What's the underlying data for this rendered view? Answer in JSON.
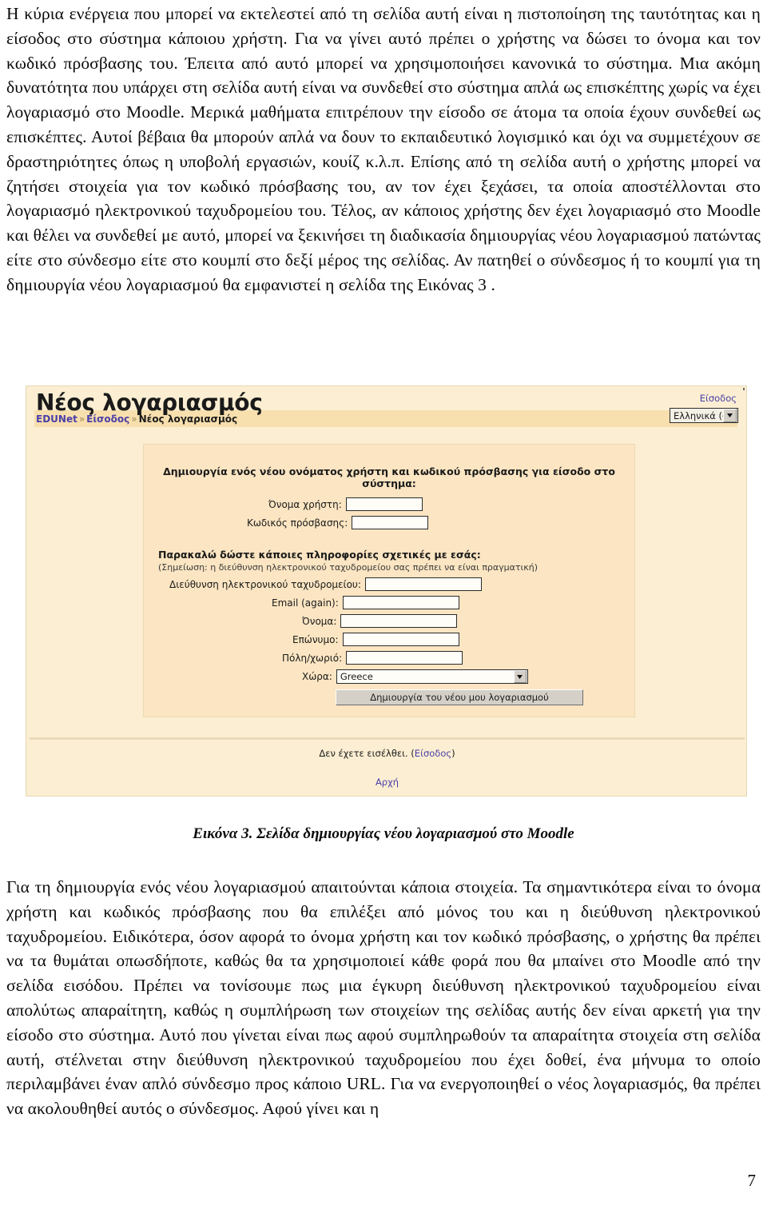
{
  "document": {
    "page_number": "7",
    "paragraph_top": "Η κύρια ενέργεια που μπορεί να εκτελεστεί από τη σελίδα αυτή είναι η πιστοποίηση της ταυτότητας και η είσοδος στο σύστημα κάποιου χρήστη. Για να γίνει αυτό πρέπει ο χρήστης να δώσει το όνομα και τον κωδικό πρόσβασης του. Έπειτα από αυτό μπορεί να χρησιμοποιήσει κανονικά το σύστημα. Μια ακόμη δυνατότητα που υπάρχει στη σελίδα αυτή είναι να συνδεθεί στο σύστημα απλά ως επισκέπτης χωρίς να έχει λογαριασμό στο Moodle. Μερικά μαθήματα επιτρέπουν την είσοδο σε άτομα τα οποία έχουν συνδεθεί ως επισκέπτες. Αυτοί βέβαια θα μπορούν απλά να δουν το εκπαιδευτικό λογισμικό και όχι να συμμετέχουν σε δραστηριότητες όπως η υποβολή εργασιών, κουίζ κ.λ.π. Επίσης από τη σελίδα αυτή ο χρήστης μπορεί να ζητήσει στοιχεία για τον κωδικό πρόσβασης του, αν τον έχει ξεχάσει, τα οποία αποστέλλονται στο λογαριασμό ηλεκτρονικού ταχυδρομείου του. Τέλος, αν κάποιος χρήστης δεν έχει λογαριασμό στο Moodle και θέλει να συνδεθεί με αυτό, μπορεί να ξεκινήσει τη διαδικασία δημιουργίας νέου λογαριασμού πατώντας είτε στο σύνδεσμο είτε στο κουμπί στο δεξί μέρος της σελίδας. Αν πατηθεί ο σύνδεσμος ή το κουμπί για τη δημιουργία νέου λογαριασμού θα εμφανιστεί η σελίδα της Εικόνας 3 .",
    "figure_caption": "Εικόνα 3. Σελίδα δημιουργίας νέου λογαριασμού στο Moodle",
    "paragraph_bottom": "Για τη δημιουργία ενός νέου λογαριασμού απαιτούνται κάποια στοιχεία. Τα σημαντικότερα είναι το όνομα χρήστη και κωδικός πρόσβασης που θα επιλέξει από μόνος του και η διεύθυνση ηλεκτρονικού ταχυδρομείου. Ειδικότερα, όσον αφορά το όνομα χρήστη και τον κωδικό πρόσβασης, ο χρήστης θα πρέπει να τα θυμάται οπωσδήποτε, καθώς θα τα χρησιμοποιεί κάθε φορά που θα μπαίνει στο Moodle από την σελίδα εισόδου. Πρέπει να τονίσουμε πως μια έγκυρη διεύθυνση ηλεκτρονικού ταχυδρομείου είναι απολύτως απαραίτητη, καθώς η συμπλήρωση των στοιχείων της σελίδας αυτής δεν είναι αρκετή για την είσοδο στο σύστημα. Αυτό που γίνεται είναι πως αφού συμπληρωθούν τα απαραίτητα στοιχεία στη σελίδα αυτή, στέλνεται στην διεύθυνση ηλεκτρονικού ταχυδρομείου που έχει δοθεί, ένα μήνυμα το οποίο περιλαμβάνει έναν απλό σύνδεσμο προς κάποιο URL. Για να ενεργοποιηθεί ο νέος λογαριασμός, θα πρέπει να ακολουθηθεί αυτός ο σύνδεσμος. Αφού γίνει και η"
  },
  "screenshot": {
    "title": "Νέος λογαριασμός",
    "login_link": "Είσοδος",
    "language_selected": "Ελληνικά (el)",
    "breadcrumb": {
      "site": "EDUNet",
      "separator": "»",
      "parent": "Είσοδος",
      "current": "Νέος λογαριασμός"
    },
    "form": {
      "section_credentials_title": "Δημιουργία ενός νέου ονόματος χρήστη και κωδικού πρόσβασης για είσοδο στο σύστημα:",
      "username_label": "Όνομα χρήστη:",
      "username_value": "",
      "password_label": "Κωδικός πρόσβασης:",
      "password_value": "",
      "section_info_title": "Παρακαλώ δώστε κάποιες πληροφορίες σχετικές με εσάς:",
      "section_info_note": "(Σημείωση: η διεύθυνση ηλεκτρονικού ταχυδρομείου σας πρέπει να είναι πραγματική)",
      "email_label": "Διεύθυνση ηλεκτρονικού ταχυδρομείου:",
      "email_value": "",
      "email_again_label": "Email (again):",
      "email_again_value": "",
      "firstname_label": "Όνομα:",
      "firstname_value": "",
      "lastname_label": "Επώνυμο:",
      "lastname_value": "",
      "city_label": "Πόλη/χωριό:",
      "city_value": "",
      "country_label": "Χώρα:",
      "country_value": "Greece",
      "submit_label": "Δημιουργία του νέου μου λογαριασμού"
    },
    "footer": {
      "status_text": "Δεν έχετε εισέλθει. (",
      "status_link": "Είσοδος",
      "status_text_end": ")",
      "home_link": "Αρχή"
    },
    "colors": {
      "page_background": "#fbeed2",
      "panel_background": "#fbe5c2",
      "breadcrumb_background": "#f7dfae",
      "link": "#4b3fa8",
      "button_face": "#d4d0c8",
      "divider": "#e8d9b8"
    }
  }
}
